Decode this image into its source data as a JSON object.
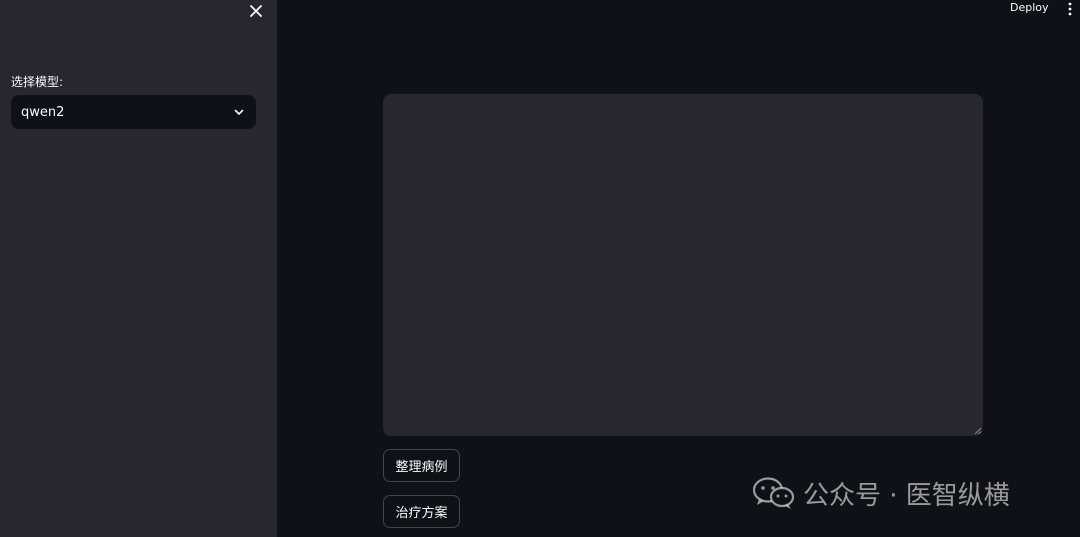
{
  "sidebar": {
    "select_label": "选择模型:",
    "select_value": "qwen2"
  },
  "header": {
    "deploy_label": "Deploy"
  },
  "main": {
    "textarea_value": "",
    "buttons": [
      {
        "label": "整理病例"
      },
      {
        "label": "治疗方案"
      }
    ]
  },
  "watermark": {
    "text": "公众号 · 医智纵横"
  },
  "icons": {
    "close": "close-icon",
    "chevron": "chevron-down-icon",
    "more": "more-vertical-icon",
    "wechat": "wechat-icon"
  },
  "colors": {
    "background": "#0e1117",
    "sidebar": "#262730",
    "text": "#fafafa"
  }
}
